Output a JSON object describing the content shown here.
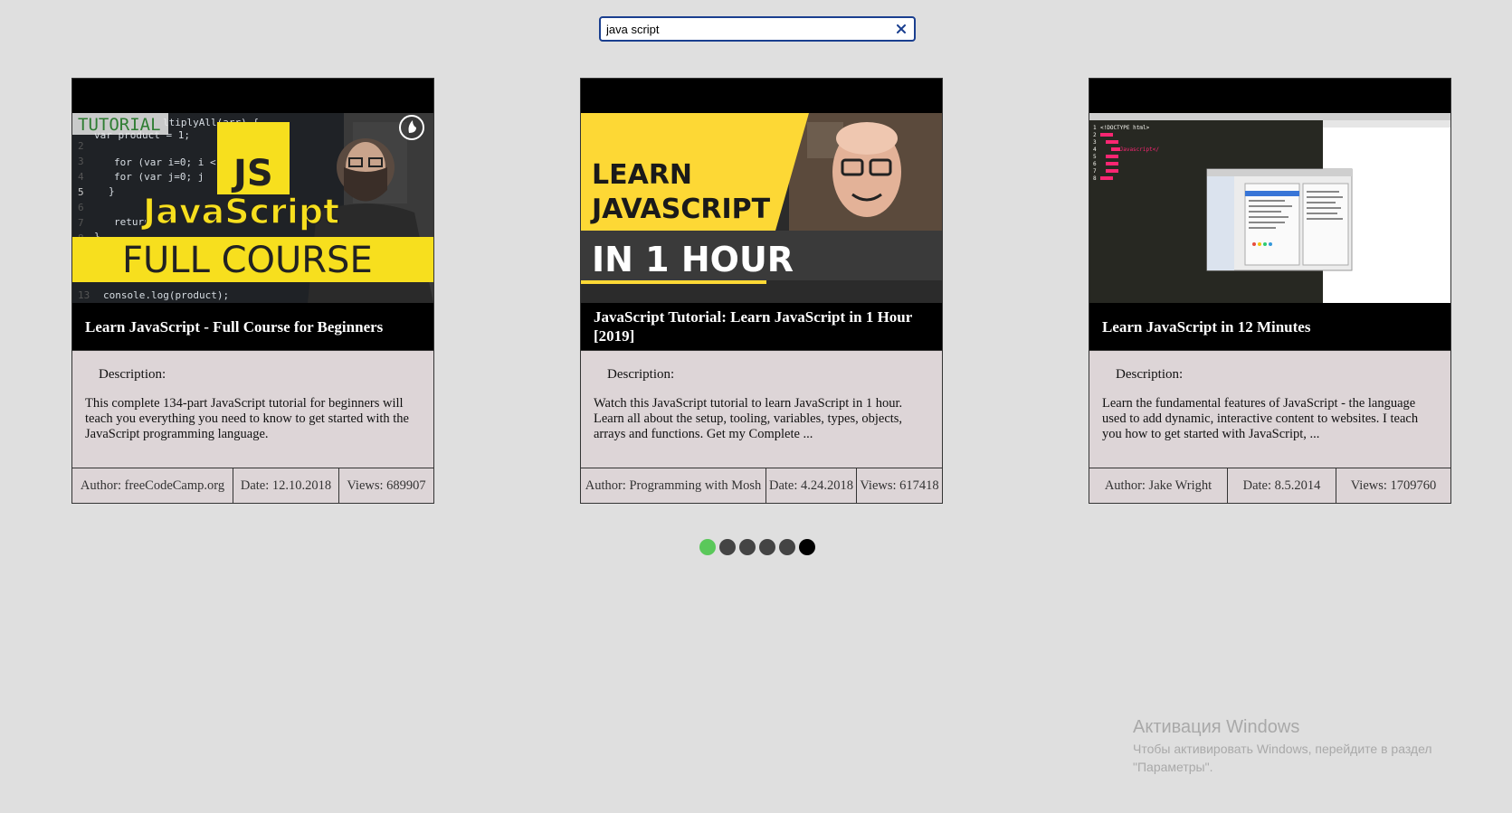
{
  "search": {
    "value": "java script",
    "clear_icon": "close-icon"
  },
  "cards": [
    {
      "thumbnail": {
        "badge": "TUTORIAL",
        "logo": "JS",
        "headline": "JavaScript",
        "banner": "FULL COURSE",
        "code_lines": [
          "ltiplyAll(arr) {",
          "var product = 1;",
          "",
          "for (var i=0; i <",
          "  for (var j=0; j",
          "}",
          "",
          "return",
          "}",
          "console.log(product);"
        ],
        "line_numbers": [
          "2",
          "3",
          "4",
          "5",
          "6",
          "7",
          "8",
          "9",
          "13"
        ]
      },
      "title": "Learn JavaScript - Full Course for Beginners",
      "description_label": "Description:",
      "description": "This complete 134-part JavaScript tutorial for beginners will teach you everything you need to know to get started with the JavaScript programming language.",
      "author": "Author: freeCodeCamp.org",
      "date": "Date: 12.10.2018",
      "views": "Views: 689907"
    },
    {
      "thumbnail": {
        "line1": "LEARN",
        "line2": "JAVASCRIPT",
        "line3": "IN 1 HOUR"
      },
      "title": "JavaScript Tutorial: Learn JavaScript in 1 Hour [2019]",
      "description_label": "Description:",
      "description": "Watch this JavaScript tutorial to learn JavaScript in 1 hour. Learn all about the setup, tooling, variables, types, objects, arrays and functions. Get my Complete ...",
      "author": "Author: Programming with Mosh",
      "date": "Date: 4.24.2018",
      "views": "Views: 617418"
    },
    {
      "thumbnail": {
        "doctype": "<!DOCTYPE html>",
        "tag_text": ">Javascript</"
      },
      "title": "Learn JavaScript in 12 Minutes",
      "description_label": "Description:",
      "description": "Learn the fundamental features of JavaScript - the language used to add dynamic, interactive content to websites. I teach you how to get started with JavaScript, ...",
      "author": "Author: Jake Wright",
      "date": "Date: 8.5.2014",
      "views": "Views: 1709760"
    }
  ],
  "pagination": {
    "count": 6,
    "active_index": 0,
    "colors": {
      "active": "#5ac85a",
      "inactive": "#444444",
      "last": "#000000"
    }
  },
  "watermark": {
    "title": "Активация Windows",
    "text": "Чтобы активировать Windows, перейдите в раздел \"Параметры\"."
  },
  "colors": {
    "background": "#dfdfdf",
    "card_body": "#ddd5d7",
    "search_border": "#1a3f8f",
    "js_yellow": "#f7df1e",
    "mosh_yellow": "#fdd835"
  }
}
